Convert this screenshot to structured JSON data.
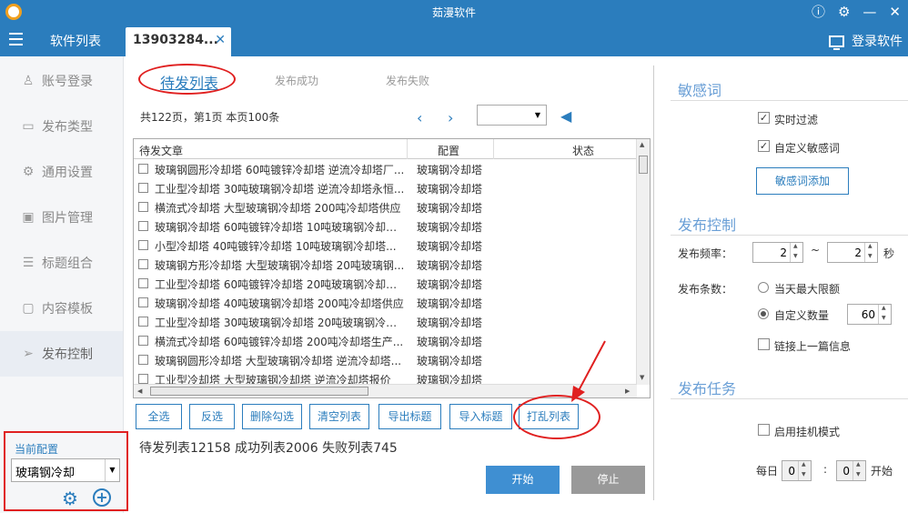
{
  "window": {
    "title": "茹漫软件"
  },
  "nav": {
    "section_label": "软件列表",
    "active_tab": "13903284...",
    "login": "登录软件"
  },
  "sidebar": {
    "items": [
      {
        "icon": "user-icon",
        "label": "账号登录"
      },
      {
        "icon": "folder-icon",
        "label": "发布类型"
      },
      {
        "icon": "gear-icon",
        "label": "通用设置"
      },
      {
        "icon": "image-icon",
        "label": "图片管理"
      },
      {
        "icon": "list-icon",
        "label": "标题组合"
      },
      {
        "icon": "template-icon",
        "label": "内容模板"
      },
      {
        "icon": "send-icon",
        "label": "发布控制"
      }
    ],
    "config_label": "当前配置",
    "config_value": "玻璃钢冷却"
  },
  "main": {
    "tabs": [
      "待发列表",
      "发布成功",
      "发布失败"
    ],
    "page_info": "共122页，第1页 本页100条",
    "columns": [
      "待发文章",
      "配置",
      "状态"
    ],
    "rows": [
      {
        "title": "玻璃钢圆形冷却塔 60吨镀锌冷却塔 逆流冷却塔厂...",
        "config": "玻璃钢冷却塔"
      },
      {
        "title": "工业型冷却塔 30吨玻璃钢冷却塔 逆流冷却塔永恒...",
        "config": "玻璃钢冷却塔"
      },
      {
        "title": "横流式冷却塔 大型玻璃钢冷却塔 200吨冷却塔供应",
        "config": "玻璃钢冷却塔"
      },
      {
        "title": "玻璃钢冷却塔 60吨镀锌冷却塔 10吨玻璃钢冷却塔...",
        "config": "玻璃钢冷却塔"
      },
      {
        "title": "小型冷却塔 40吨镀锌冷却塔 10吨玻璃钢冷却塔...",
        "config": "玻璃钢冷却塔"
      },
      {
        "title": "玻璃钢方形冷却塔 大型玻璃钢冷却塔 20吨玻璃钢...",
        "config": "玻璃钢冷却塔"
      },
      {
        "title": "工业型冷却塔 60吨镀锌冷却塔 20吨玻璃钢冷却塔...",
        "config": "玻璃钢冷却塔"
      },
      {
        "title": "玻璃钢冷却塔 40吨玻璃钢冷却塔 200吨冷却塔供应",
        "config": "玻璃钢冷却塔"
      },
      {
        "title": "工业型冷却塔 30吨玻璃钢冷却塔 20吨玻璃钢冷却...",
        "config": "玻璃钢冷却塔"
      },
      {
        "title": "横流式冷却塔 60吨镀锌冷却塔 200吨冷却塔生产...",
        "config": "玻璃钢冷却塔"
      },
      {
        "title": "玻璃钢圆形冷却塔 大型玻璃钢冷却塔 逆流冷却塔...",
        "config": "玻璃钢冷却塔"
      },
      {
        "title": "工业型冷却塔 大型玻璃钢冷却塔 逆流冷却塔报价",
        "config": "玻璃钢冷却塔"
      }
    ],
    "buttons": [
      "全选",
      "反选",
      "删除勾选",
      "清空列表",
      "导出标题",
      "导入标题",
      "打乱列表"
    ],
    "stats": "待发列表12158  成功列表2006  失败列表745",
    "start": "开始",
    "stop": "停止"
  },
  "right": {
    "sensitive": {
      "title": "敏感词",
      "realtime": "实时过滤",
      "custom": "自定义敏感词",
      "add_button": "敏感词添加"
    },
    "publish_control": {
      "title": "发布控制",
      "freq_label": "发布频率：",
      "freq_min": "2",
      "tilde": "~",
      "freq_max": "2",
      "sec": "秒",
      "count_label": "发布条数：",
      "max_today": "当天最大限额",
      "custom_count": "自定义数量",
      "custom_value": "60",
      "link_prev": "链接上一篇信息"
    },
    "task": {
      "title": "发布任务",
      "hang_mode": "启用挂机模式",
      "daily": "每日",
      "hour": "0",
      "colon": ":",
      "minute": "0",
      "start": "开始"
    }
  }
}
